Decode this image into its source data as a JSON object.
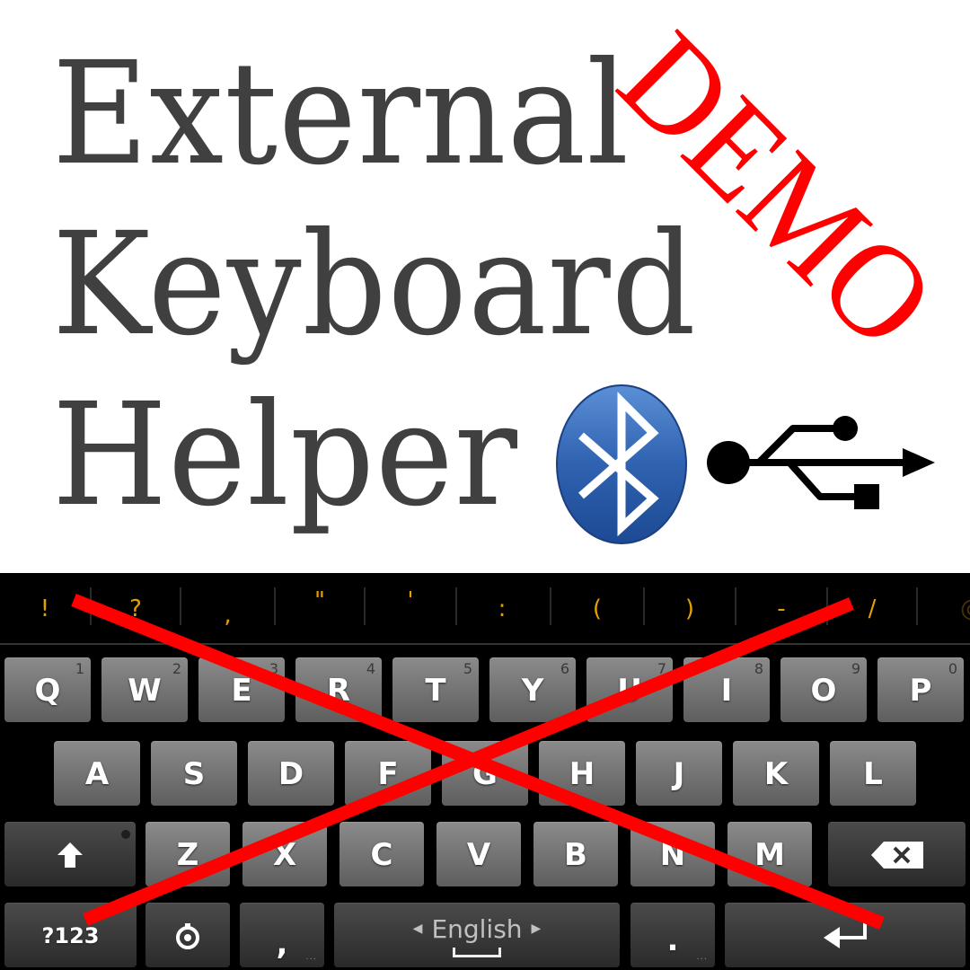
{
  "banner": {
    "title_lines": [
      "External",
      "Keyboard",
      "Helper"
    ],
    "watermark": "DEMO",
    "icons": [
      "bluetooth-icon",
      "usb-icon"
    ],
    "colors": {
      "title": "#404040",
      "watermark": "#ff0000",
      "bluetooth_blue": "#2f62b0"
    }
  },
  "keyboard": {
    "suggestions": [
      "!",
      "?",
      ",",
      "\"",
      "'",
      ":",
      "(",
      ")",
      "-",
      "/",
      "@"
    ],
    "rows": [
      [
        {
          "label": "Q",
          "hint": "1"
        },
        {
          "label": "W",
          "hint": "2"
        },
        {
          "label": "E",
          "hint": "3"
        },
        {
          "label": "R",
          "hint": "4"
        },
        {
          "label": "T",
          "hint": "5"
        },
        {
          "label": "Y",
          "hint": "6"
        },
        {
          "label": "U",
          "hint": "7"
        },
        {
          "label": "I",
          "hint": "8"
        },
        {
          "label": "O",
          "hint": "9"
        },
        {
          "label": "P",
          "hint": "0"
        }
      ],
      [
        {
          "label": "A"
        },
        {
          "label": "S"
        },
        {
          "label": "D"
        },
        {
          "label": "F"
        },
        {
          "label": "G"
        },
        {
          "label": "H"
        },
        {
          "label": "J"
        },
        {
          "label": "K"
        },
        {
          "label": "L"
        }
      ],
      [
        {
          "label": "Z"
        },
        {
          "label": "X"
        },
        {
          "label": "C"
        },
        {
          "label": "V"
        },
        {
          "label": "B"
        },
        {
          "label": "N"
        },
        {
          "label": "M"
        }
      ]
    ],
    "symbols_key": "?123",
    "comma_key": ",",
    "space_language": "English",
    "period_key": ".",
    "more_indicator": "...",
    "suggestion_color": "#e3a000",
    "crossed_out": true,
    "cross_color": "#ff0000"
  }
}
